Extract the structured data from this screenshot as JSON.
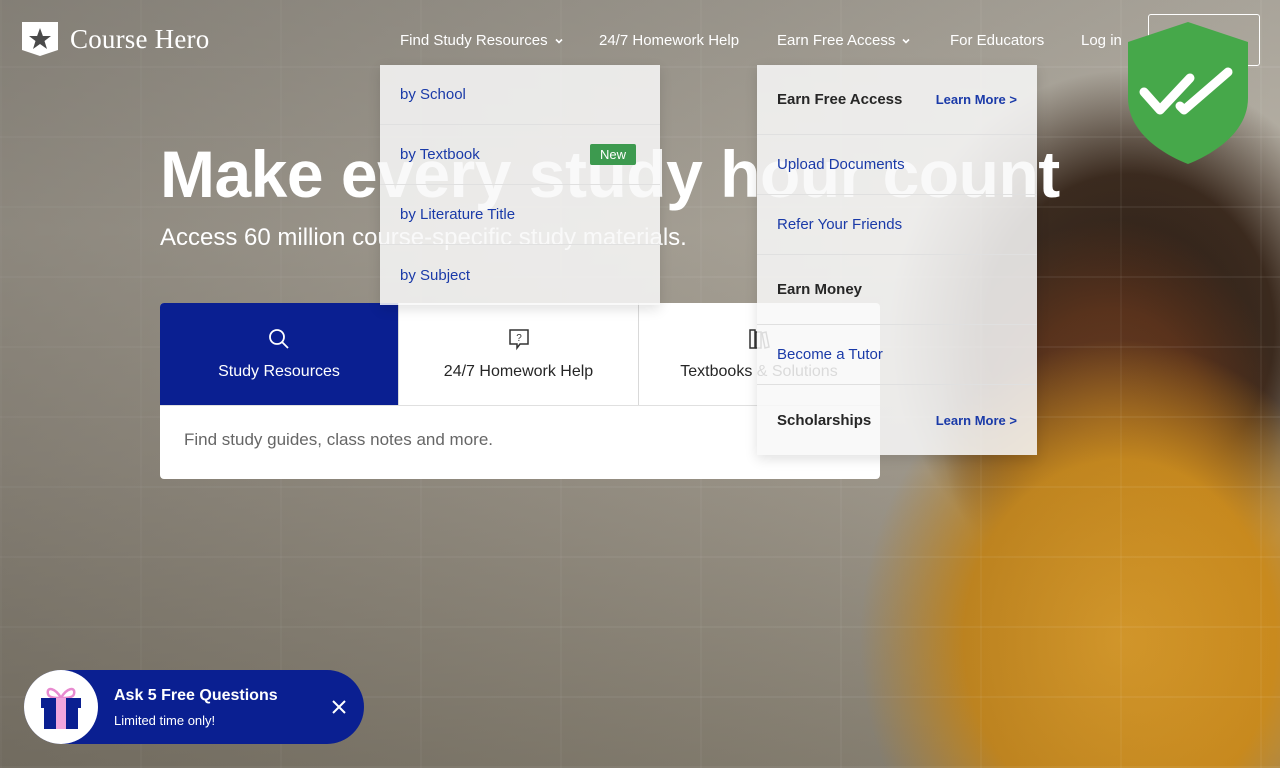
{
  "brand": {
    "name": "Course Hero",
    "primary": "#0a1f91",
    "link": "#1a3aa8",
    "success": "#3d9a4f"
  },
  "nav": {
    "find_study": "Find Study Resources",
    "homework_help": "24/7 Homework Help",
    "earn_free": "Earn Free Access",
    "educators": "For Educators",
    "login": "Log in"
  },
  "hero": {
    "title": "Make every study hour count",
    "subtitle": "Access 60 million course-specific study materials."
  },
  "tabs": [
    {
      "label": "Study Resources",
      "icon": "search-icon",
      "active": true
    },
    {
      "label": "24/7 Homework Help",
      "icon": "question-bubble-icon",
      "active": false
    },
    {
      "label": "Textbooks & Solutions",
      "icon": "books-icon",
      "active": false
    }
  ],
  "search": {
    "placeholder": "Find study guides, class notes and more."
  },
  "study_dropdown": {
    "items": [
      "by School",
      "by Textbook",
      "by Literature Title",
      "by Subject"
    ],
    "new_badge": "New"
  },
  "earn_dropdown": {
    "earn_free_heading": "Earn Free Access",
    "learn_more_1": "Learn More >",
    "upload": "Upload Documents",
    "refer": "Refer Your Friends",
    "earn_money_heading": "Earn Money",
    "tutor": "Become a Tutor",
    "scholarships_heading": "Scholarships",
    "learn_more_2": "Learn More >"
  },
  "promo": {
    "title": "Ask 5 Free Questions",
    "subtitle": "Limited time only!",
    "icon": "gift-icon"
  }
}
